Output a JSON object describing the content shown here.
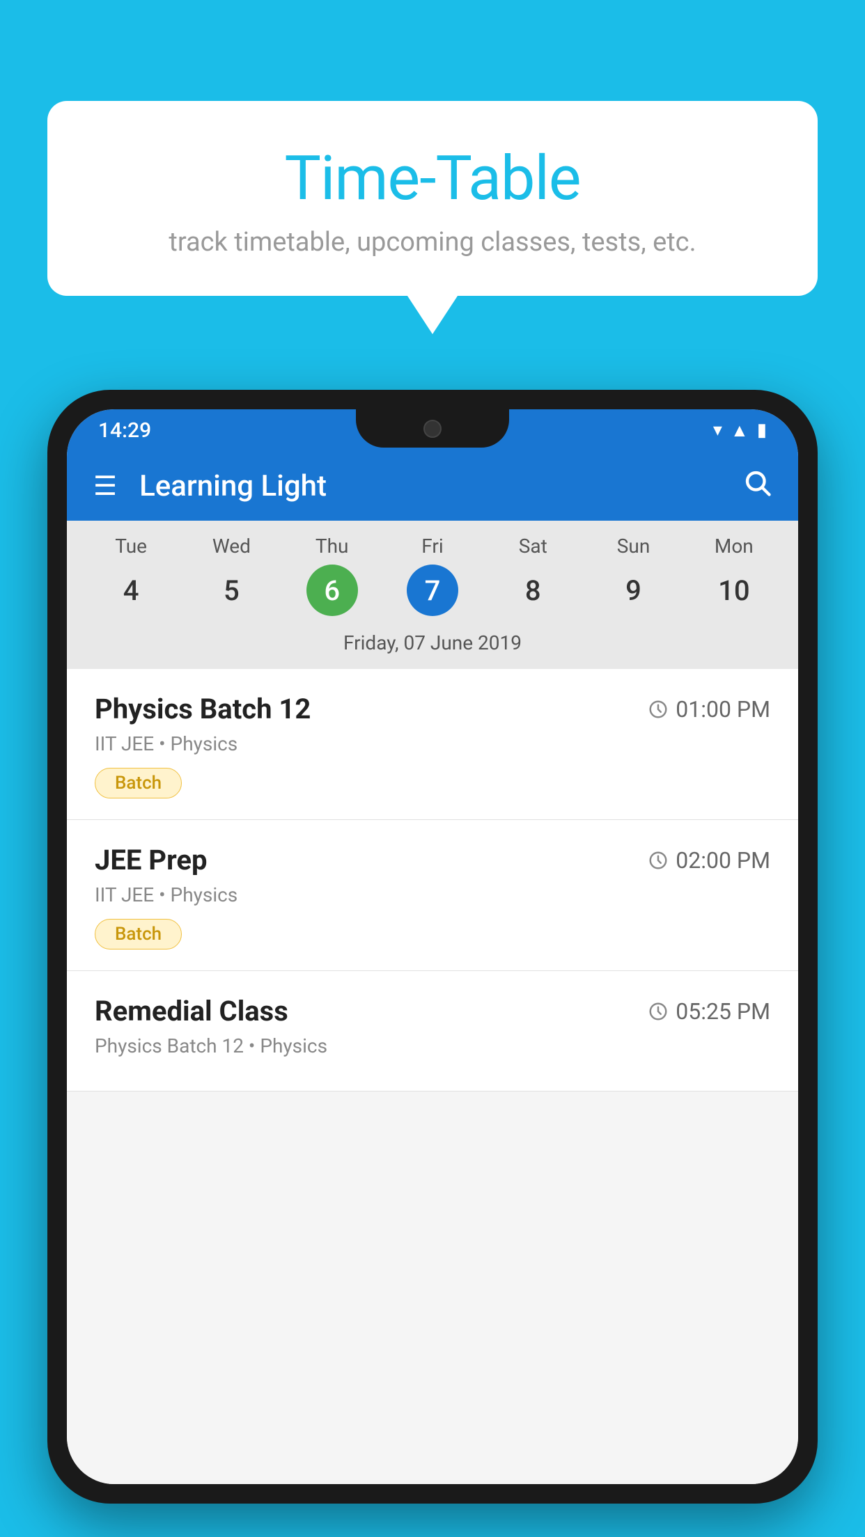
{
  "background_color": "#1bbde8",
  "bubble": {
    "title": "Time-Table",
    "subtitle": "track timetable, upcoming classes, tests, etc."
  },
  "phone": {
    "status_bar": {
      "time": "14:29",
      "wifi": "▾",
      "signal": "▲",
      "battery": "▮"
    },
    "app_bar": {
      "title": "Learning Light",
      "menu_icon": "☰",
      "search_icon": "🔍"
    },
    "calendar": {
      "days": [
        {
          "name": "Tue",
          "num": "4",
          "state": "normal"
        },
        {
          "name": "Wed",
          "num": "5",
          "state": "normal"
        },
        {
          "name": "Thu",
          "num": "6",
          "state": "today"
        },
        {
          "name": "Fri",
          "num": "7",
          "state": "selected"
        },
        {
          "name": "Sat",
          "num": "8",
          "state": "normal"
        },
        {
          "name": "Sun",
          "num": "9",
          "state": "normal"
        },
        {
          "name": "Mon",
          "num": "10",
          "state": "normal"
        }
      ],
      "selected_date_label": "Friday, 07 June 2019"
    },
    "schedule": {
      "items": [
        {
          "title": "Physics Batch 12",
          "time": "01:00 PM",
          "subtitle": "IIT JEE • Physics",
          "badge": "Batch"
        },
        {
          "title": "JEE Prep",
          "time": "02:00 PM",
          "subtitle": "IIT JEE • Physics",
          "badge": "Batch"
        },
        {
          "title": "Remedial Class",
          "time": "05:25 PM",
          "subtitle": "Physics Batch 12 • Physics",
          "badge": null
        }
      ]
    }
  }
}
